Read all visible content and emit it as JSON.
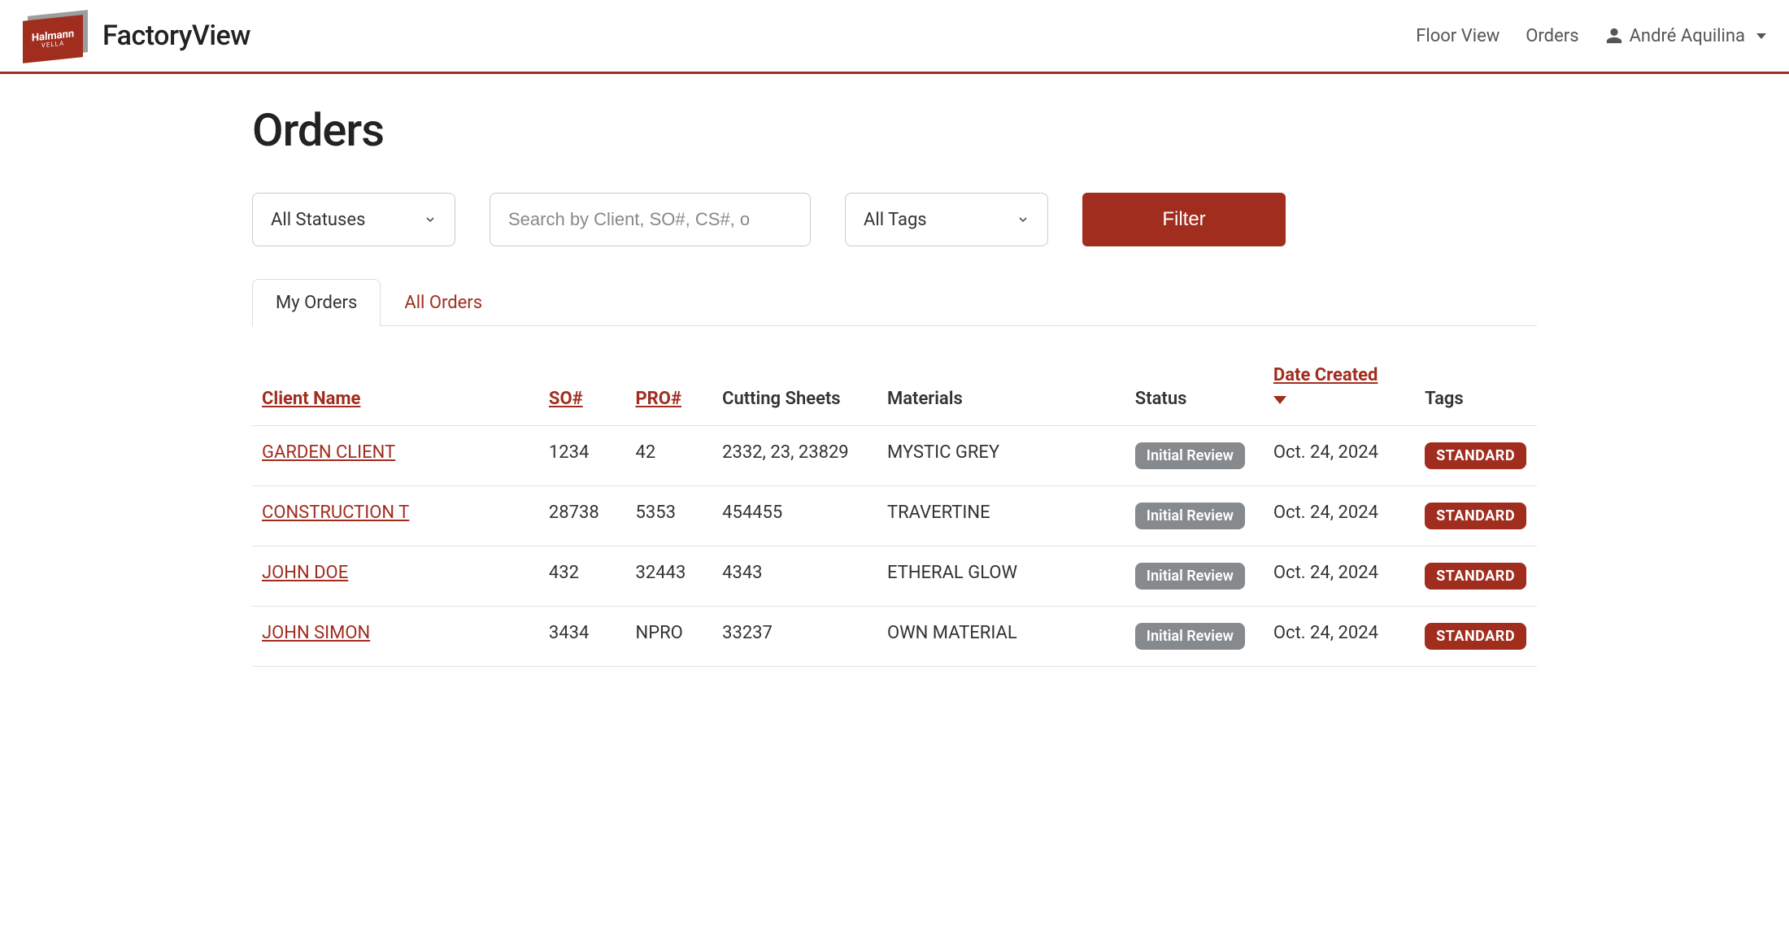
{
  "brand": {
    "logo_line1": "Halmann",
    "logo_line2": "VELLA",
    "app_name": "FactoryView"
  },
  "nav": {
    "floor_view": "Floor View",
    "orders": "Orders",
    "user_name": "André Aquilina"
  },
  "page": {
    "title": "Orders"
  },
  "filters": {
    "status_label": "All Statuses",
    "search_placeholder": "Search by Client, SO#, CS#, o",
    "tag_label": "All Tags",
    "filter_button": "Filter"
  },
  "tabs": {
    "my_orders": "My Orders",
    "all_orders": "All Orders"
  },
  "table": {
    "headers": {
      "client": "Client Name",
      "so": "SO#",
      "pro": "PRO#",
      "cutting_sheets": "Cutting Sheets",
      "materials": "Materials",
      "status": "Status",
      "date_created": "Date Created",
      "tags": "Tags"
    },
    "rows": [
      {
        "client": "GARDEN CLIENT",
        "so": "1234",
        "pro": "42",
        "cs": "2332, 23, 23829",
        "materials": "MYSTIC GREY",
        "status": "Initial Review",
        "date": "Oct. 24, 2024",
        "tag": "STANDARD"
      },
      {
        "client": "CONSTRUCTION T",
        "so": "28738",
        "pro": "5353",
        "cs": "454455",
        "materials": "TRAVERTINE",
        "status": "Initial Review",
        "date": "Oct. 24, 2024",
        "tag": "STANDARD"
      },
      {
        "client": "JOHN DOE",
        "so": "432",
        "pro": "32443",
        "cs": "4343",
        "materials": "ETHERAL GLOW",
        "status": "Initial Review",
        "date": "Oct. 24, 2024",
        "tag": "STANDARD"
      },
      {
        "client": "JOHN SIMON",
        "so": "3434",
        "pro": "NPRO",
        "cs": "33237",
        "materials": "OWN MATERIAL",
        "status": "Initial Review",
        "date": "Oct. 24, 2024",
        "tag": "STANDARD"
      }
    ]
  }
}
